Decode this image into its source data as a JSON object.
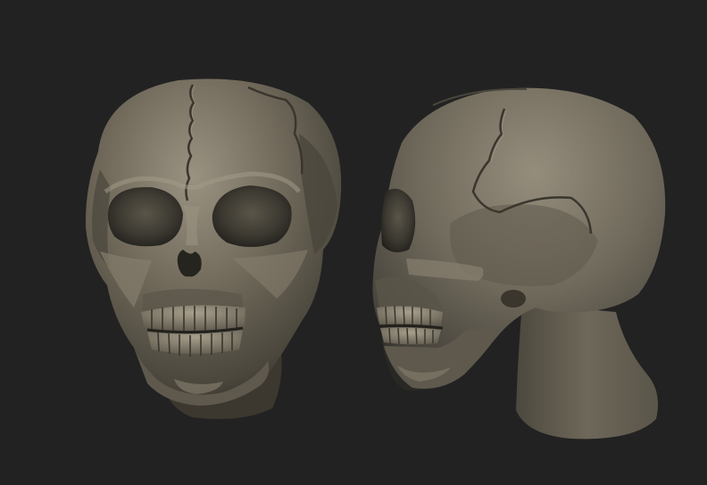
{
  "scene": {
    "background_color": "#222222",
    "model_color": "#6e685a",
    "model_highlight": "#9c9482",
    "model_shadow": "#2e2b25",
    "views": [
      {
        "subject": "skull-front-view"
      },
      {
        "subject": "skull-side-view"
      }
    ]
  }
}
